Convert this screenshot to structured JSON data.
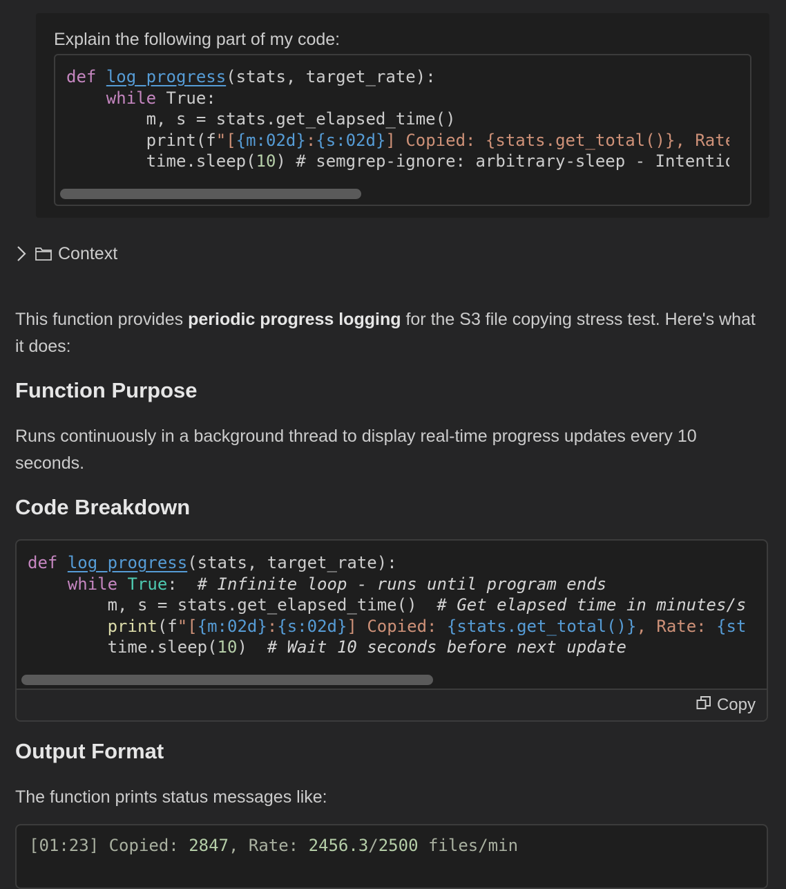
{
  "prompt": {
    "text": "Explain the following part of my code:",
    "code": [
      "def log_progress(stats, target_rate):",
      "    while True:",
      "        m, s = stats.get_elapsed_time()",
      "        print(f\"[{m:02d}:{s:02d}] Copied: {stats.get_total()}, Rate",
      "        time.sleep(10) # semgrep-ignore: arbitrary-sleep - Intentio"
    ]
  },
  "context": {
    "label": "Context"
  },
  "intro": {
    "pre": "This function provides ",
    "bold": "periodic progress logging",
    "post": " for the S3 file copying stress test. Here's what it does:"
  },
  "sections": {
    "purpose_heading": "Function Purpose",
    "purpose_text": "Runs continuously in a background thread to display real-time progress updates every 10 seconds.",
    "breakdown_heading": "Code Breakdown",
    "output_heading": "Output Format",
    "output_text": "The function prints status messages like:"
  },
  "breakdown_code": [
    "def log_progress(stats, target_rate):",
    "    while True:  # Infinite loop - runs until program ends",
    "        m, s = stats.get_elapsed_time()  # Get elapsed time in minutes/s",
    "        print(f\"[{m:02d}:{s:02d}] Copied: {stats.get_total()}, Rate: {st",
    "        time.sleep(10)  # Wait 10 seconds before next update"
  ],
  "copy_label": "Copy",
  "output_sample": "[01:23] Copied: 2847, Rate: 2456.3/2500 files/min",
  "colors": {
    "background": "#252526",
    "code_background": "#1e1e1e",
    "keyword": "#c586c0",
    "function": "#569cd6",
    "string": "#ce9178",
    "number": "#b5cea8",
    "builtin": "#dcdcaa"
  },
  "icons": [
    "chevron-right-icon",
    "folder-icon",
    "copy-icon"
  ]
}
